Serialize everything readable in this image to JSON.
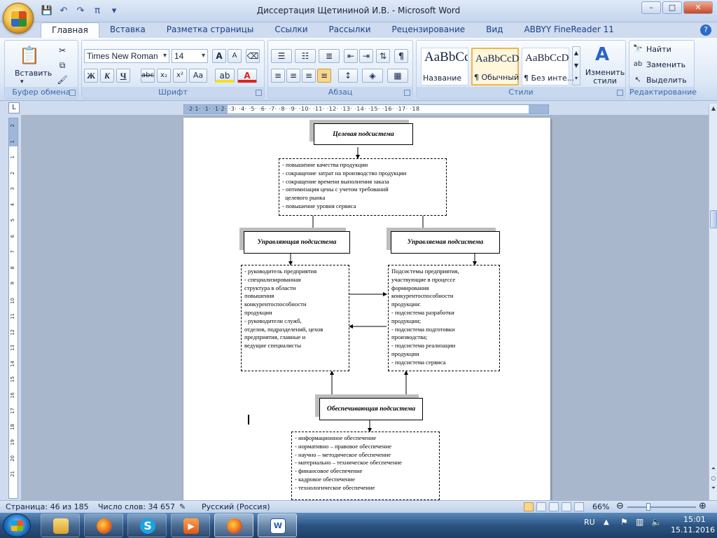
{
  "window": {
    "title": "Диссертация Щетининой И.В. - Microsoft Word",
    "controls": [
      "–",
      "□",
      "✕"
    ]
  },
  "quick_access": [
    "save-icon",
    "undo-icon",
    "redo-icon",
    "pi-icon",
    "customize-icon"
  ],
  "tabs": [
    "Главная",
    "Вставка",
    "Разметка страницы",
    "Ссылки",
    "Рассылки",
    "Рецензирование",
    "Вид",
    "ABBYY FineReader 11"
  ],
  "active_tab": "Главная",
  "ribbon": {
    "clipboard": {
      "label": "Буфер обмена",
      "paste": "Вставить"
    },
    "font": {
      "label": "Шрифт",
      "family": "Times New Roman",
      "size": "14",
      "buttons": {
        "bold": "Ж",
        "italic": "К",
        "underline": "Ч",
        "strike": "abc",
        "sub": "x₂",
        "sup": "x²",
        "case": "Аа",
        "grow": "A",
        "shrink": "A"
      }
    },
    "paragraph": {
      "label": "Абзац"
    },
    "styles": {
      "label": "Стили",
      "items": [
        {
          "sample": "AaBbCc",
          "name": "Название"
        },
        {
          "sample": "AaBbCcDc",
          "name": "¶ Обычный"
        },
        {
          "sample": "AaBbCcDc",
          "name": "¶ Без инте..."
        }
      ],
      "change": "Изменить стили"
    },
    "editing": {
      "label": "Редактирование",
      "find": "Найти",
      "replace": "Заменить",
      "select": "Выделить"
    }
  },
  "ruler": {
    "ticks": "·2·1·  ·1·  ·1·2·  ·3·  ·4·  ·5·  ·6·  ·7·  ·8·  ·9·  ·10·  ·11·  ·12·  ·13·  ·14·  ·15·  ·16·  ·17·  ·18",
    "vertical": [
      "2",
      "1",
      "1",
      "2",
      "3",
      "4",
      "5",
      "6",
      "7",
      "8",
      "9",
      "10",
      "11",
      "12",
      "13",
      "14",
      "15",
      "16",
      "17",
      "18",
      "19",
      "20",
      "21"
    ]
  },
  "diagram": {
    "target_header": "Целевая подсистема",
    "target_items": [
      "- повышение качества продукции",
      "- сокращение затрат на производство продукции",
      "- сокращение времени выполнения заказа",
      "- оптимизация цены с учетом требований",
      "  целевого рынка",
      "- повышение уровня сервиса"
    ],
    "managing_header": "Управляющая подсистема",
    "managing_items": [
      "- руководитель предприятия",
      "- специализированная",
      "структура в области",
      "повышения",
      "конкурентоспособности",
      "продукции",
      "- руководители служб,",
      "отделов, подразделений, цехов",
      "предприятия, главные и",
      "ведущие специалисты"
    ],
    "managed_header": "Управляемая подсистема",
    "managed_items": [
      "Подсистемы предприятия,",
      "участвующие в процессе",
      "формирования",
      "конкурентоспособности",
      "продукции:",
      "- подсистема разработки",
      "продукции;",
      "- подсистема подготовки",
      "производства;",
      "- подсистема реализации",
      "продукции",
      "- подсистема сервиса"
    ],
    "support_header": "Обеспечивающая подсистема",
    "support_items": [
      "- информационное обеспечение",
      "- нормативно – правовое обеспечение",
      "- научно – методическое обеспечение",
      "- материально – техническое обеспечение",
      "- финансовое обеспечение",
      "- кадровое обеспечение",
      "- технологическое обеспечение"
    ]
  },
  "status": {
    "page": "Страница: 46 из 185",
    "words": "Число слов: 34 657",
    "language": "Русский (Россия)",
    "zoom": "66%",
    "zoom_percent": 66
  },
  "taskbar": {
    "apps": [
      "explorer",
      "firefox",
      "skype",
      "media-player",
      "firefox",
      "word"
    ],
    "language": "RU",
    "time": "15:01",
    "date": "15.11.2016"
  }
}
